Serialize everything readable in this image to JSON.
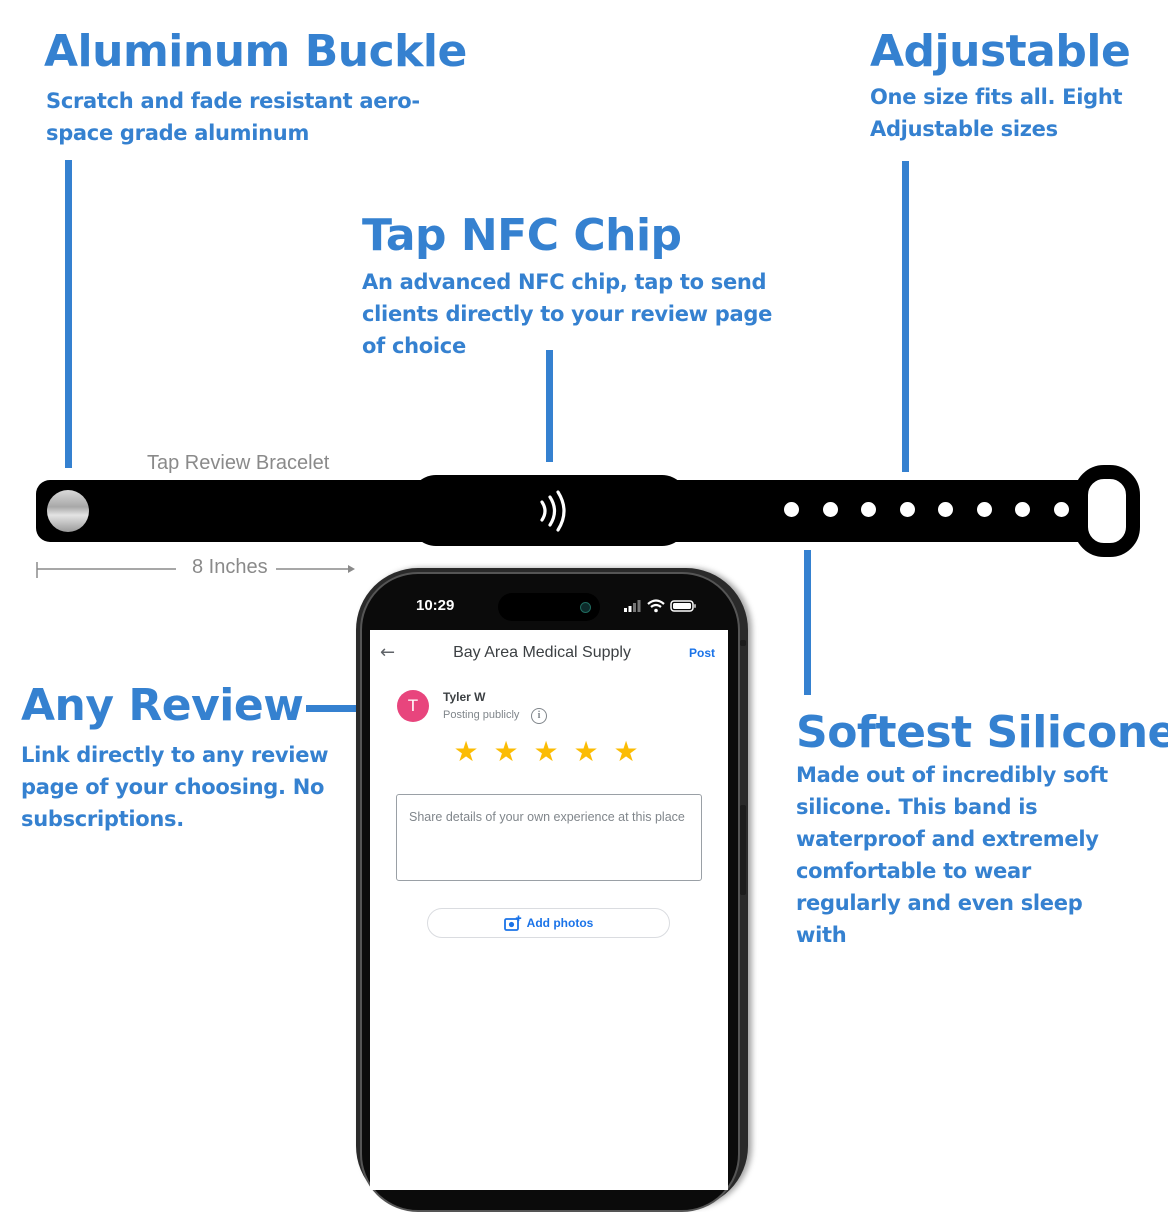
{
  "features": {
    "buckle": {
      "title": "Aluminum Buckle",
      "desc_lines": [
        "Scratch and fade resistant aero-",
        "space grade aluminum"
      ]
    },
    "adjustable": {
      "title": "Adjustable",
      "desc_lines": [
        "One size fits all.  Eight",
        "Adjustable sizes"
      ]
    },
    "nfc": {
      "title": "Tap NFC Chip",
      "desc_lines": [
        "An advanced NFC chip, tap to send",
        "clients directly to your review page",
        "of choice"
      ]
    },
    "review": {
      "title": "Any Review",
      "desc_lines": [
        "Link directly to any review",
        "page of your choosing.  No",
        "subscriptions."
      ]
    },
    "silicone": {
      "title": "Softest Silicone",
      "desc_lines": [
        "Made out of incredibly soft",
        "silicone. This band is",
        "waterproof and extremely",
        "comfortable to wear",
        "regularly and even sleep",
        "with"
      ]
    }
  },
  "bracelet": {
    "label": "Tap Review Bracelet",
    "length_label": "8 Inches",
    "adjustment_holes": 8,
    "icons": {
      "buckle": "metal-buckle",
      "chip": "nfc-contactless-icon",
      "loop": "band-loop"
    }
  },
  "phone": {
    "status_time": "10:29",
    "status_icons": [
      "signal-icon",
      "wifi-icon",
      "battery-icon"
    ],
    "nav": {
      "back_icon": "←",
      "title": "Bay Area Medical Supply",
      "post_label": "Post"
    },
    "user": {
      "initial": "T",
      "name": "Tyler W",
      "visibility": "Posting publicly",
      "info_icon": "i"
    },
    "rating": {
      "value": 5,
      "max": 5,
      "star_glyph": "★"
    },
    "review_placeholder": "Share details of your own experience at this place",
    "add_photos_label": "Add photos"
  },
  "colors": {
    "accent_blue": "#3581d0",
    "star_yellow": "#fbbc04",
    "avatar_pink": "#e8457d",
    "link_blue": "#1a73e8",
    "band_black": "#000000"
  }
}
